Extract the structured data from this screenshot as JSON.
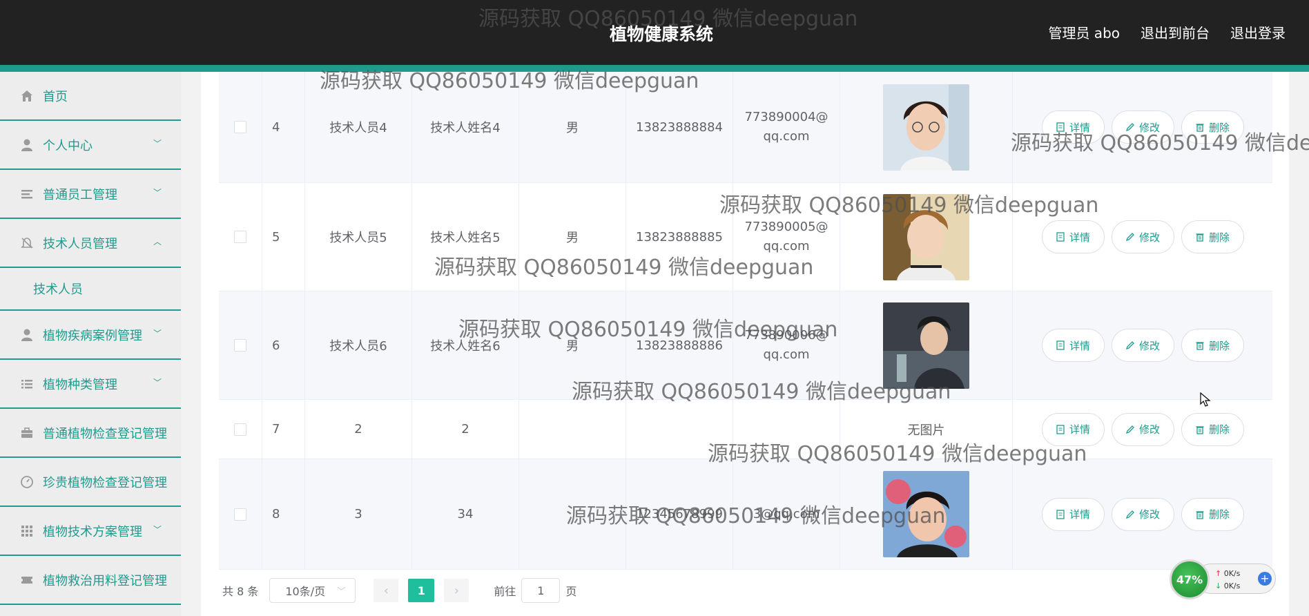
{
  "header": {
    "title": "植物健康系统",
    "admin_label": "管理员 abo",
    "to_front_label": "退出到前台",
    "logout_label": "退出登录"
  },
  "sidebar": {
    "items": [
      {
        "label": "首页",
        "icon": "home-icon"
      },
      {
        "label": "个人中心",
        "icon": "user-icon"
      },
      {
        "label": "普通员工管理",
        "icon": "sliders-icon"
      },
      {
        "label": "技术人员管理",
        "icon": "bell-off-icon",
        "expanded": true
      },
      {
        "label": "技术人员",
        "icon": ""
      },
      {
        "label": "植物疾病案例管理",
        "icon": "user-icon"
      },
      {
        "label": "植物种类管理",
        "icon": "list-icon"
      },
      {
        "label": "普通植物检查登记管理",
        "icon": "briefcase-icon"
      },
      {
        "label": "珍贵植物检查登记管理",
        "icon": "gauge-icon"
      },
      {
        "label": "植物技术方案管理",
        "icon": "grid-icon"
      },
      {
        "label": "植物救治用料登记管理",
        "icon": "ticket-icon"
      }
    ]
  },
  "table": {
    "rows": [
      {
        "index": "4",
        "account": "技术人员4",
        "name": "技术人姓名4",
        "gender": "男",
        "phone": "13823888884",
        "email": "773890004@qq.com",
        "photo": "photo-4"
      },
      {
        "index": "5",
        "account": "技术人员5",
        "name": "技术人姓名5",
        "gender": "男",
        "phone": "13823888885",
        "email": "773890005@qq.com",
        "photo": "photo-5"
      },
      {
        "index": "6",
        "account": "技术人员6",
        "name": "技术人姓名6",
        "gender": "男",
        "phone": "13823888886",
        "email": "773890006@qq.com",
        "photo": "photo-6"
      },
      {
        "index": "7",
        "account": "2",
        "name": "2",
        "gender": "",
        "phone": "",
        "email": "",
        "photo_text": "无图片"
      },
      {
        "index": "8",
        "account": "3",
        "name": "34",
        "gender": "",
        "phone": "12345678999",
        "email": "3@qq.com",
        "photo": "photo-8"
      }
    ],
    "ops": {
      "detail": "详情",
      "edit": "修改",
      "delete": "删除"
    }
  },
  "pager": {
    "total": "共 8 条",
    "page_size": "10条/页",
    "current": "1",
    "goto_label": "前往",
    "goto_value": "1",
    "page_suffix": "页"
  },
  "watermark": "源码获取 QQ86050149 微信deepguan",
  "net_widget": {
    "percent": "47%",
    "up": "0K/s",
    "down": "0K/s"
  },
  "colors": {
    "accent": "#1f9b8e",
    "header_bg": "#222222",
    "page_active": "#1fbf9e"
  }
}
